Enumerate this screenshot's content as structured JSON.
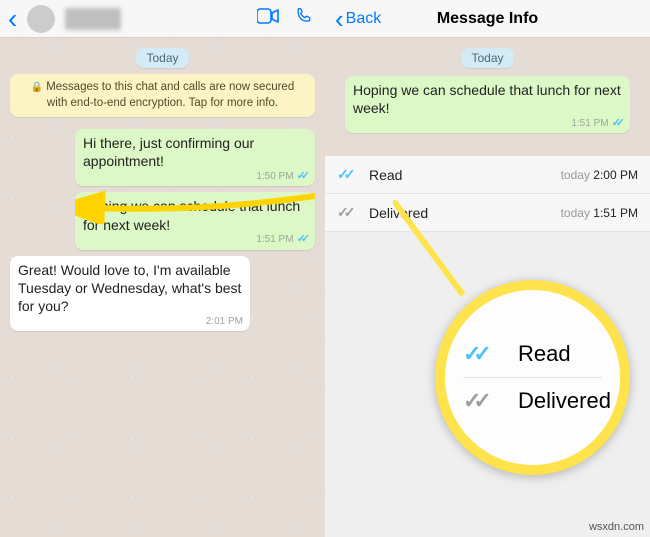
{
  "left": {
    "date": "Today",
    "encryption": "Messages to this chat and calls are now secured with end-to-end encryption. Tap for more info.",
    "messages": [
      {
        "dir": "out",
        "text": "Hi there, just confirming our appointment!",
        "time": "1:50 PM",
        "ticks": "blue"
      },
      {
        "dir": "out",
        "text": "Hoping we can schedule that lunch for next week!",
        "time": "1:51 PM",
        "ticks": "blue"
      },
      {
        "dir": "in",
        "text": "Great!  Would love to, I'm available Tuesday or Wednesday, what's best for you?",
        "time": "2:01 PM"
      }
    ]
  },
  "right": {
    "back": "Back",
    "title": "Message Info",
    "date": "Today",
    "message": {
      "text": "Hoping we can schedule that lunch for next week!",
      "time": "1:51 PM",
      "ticks": "blue"
    },
    "status": [
      {
        "kind": "read",
        "label": "Read",
        "day": "today",
        "time": "2:00 PM"
      },
      {
        "kind": "delivered",
        "label": "Delivered",
        "day": "today",
        "time": "1:51 PM"
      }
    ]
  },
  "magnifier": {
    "read": "Read",
    "delivered": "Delivered"
  },
  "watermark": "wsxdn.com"
}
